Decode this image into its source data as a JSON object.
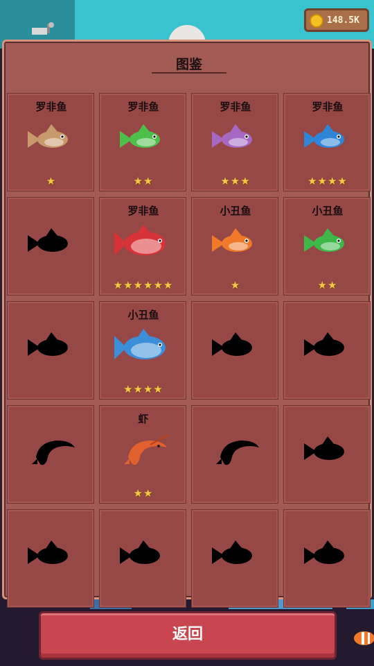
{
  "header": {
    "coin_icon": "gold-coin-icon",
    "coins": "148.5K"
  },
  "panel": {
    "title": "图鉴"
  },
  "collection": [
    {
      "name": "罗非鱼",
      "stars": "★",
      "icon": "tilapia-brown-fish-icon",
      "color": "#c79a6b",
      "locked": false
    },
    {
      "name": "罗非鱼",
      "stars": "★★",
      "icon": "tilapia-green-fish-icon",
      "color": "#4fbf4c",
      "locked": false
    },
    {
      "name": "罗非鱼",
      "stars": "★★★",
      "icon": "tilapia-purple-fish-icon",
      "color": "#a768c2",
      "locked": false
    },
    {
      "name": "罗非鱼",
      "stars": "★★★★",
      "icon": "tilapia-blue-fish-icon",
      "color": "#2f86d9",
      "locked": false
    },
    {
      "name": "",
      "stars": "",
      "icon": "locked-fish-silhouette-icon",
      "color": "#000000",
      "locked": true
    },
    {
      "name": "罗非鱼",
      "stars": "★★★★★★",
      "icon": "tilapia-red-fish-icon",
      "color": "#d9333a",
      "locked": false
    },
    {
      "name": "小丑鱼",
      "stars": "★",
      "icon": "clownfish-orange-icon",
      "color": "#f07a2a",
      "locked": false
    },
    {
      "name": "小丑鱼",
      "stars": "★★",
      "icon": "clownfish-green-icon",
      "color": "#3fb84a",
      "locked": false
    },
    {
      "name": "",
      "stars": "",
      "icon": "locked-fish-silhouette-icon",
      "color": "#000000",
      "locked": true
    },
    {
      "name": "小丑鱼",
      "stars": "★★★★",
      "icon": "clownfish-blue-icon",
      "color": "#3a8fd8",
      "locked": false
    },
    {
      "name": "",
      "stars": "",
      "icon": "locked-fish-silhouette-icon",
      "color": "#000000",
      "locked": true
    },
    {
      "name": "",
      "stars": "",
      "icon": "locked-fish-silhouette-icon",
      "color": "#000000",
      "locked": true
    },
    {
      "name": "",
      "stars": "",
      "icon": "locked-shrimp-silhouette-icon",
      "color": "#000000",
      "locked": true
    },
    {
      "name": "虾",
      "stars": "★★",
      "icon": "shrimp-orange-icon",
      "color": "#e0612f",
      "locked": false
    },
    {
      "name": "",
      "stars": "",
      "icon": "locked-shrimp-silhouette-icon",
      "color": "#000000",
      "locked": true
    },
    {
      "name": "",
      "stars": "",
      "icon": "locked-fish-silhouette-icon",
      "color": "#000000",
      "locked": true
    },
    {
      "name": "",
      "stars": "",
      "icon": "locked-fish-silhouette-icon",
      "color": "#000000",
      "locked": true
    },
    {
      "name": "",
      "stars": "",
      "icon": "locked-fish-silhouette-icon",
      "color": "#000000",
      "locked": true
    },
    {
      "name": "",
      "stars": "",
      "icon": "locked-fish-silhouette-icon",
      "color": "#000000",
      "locked": true
    },
    {
      "name": "",
      "stars": "",
      "icon": "locked-fish-silhouette-icon",
      "color": "#000000",
      "locked": true
    }
  ],
  "footer": {
    "back_label": "返回"
  }
}
